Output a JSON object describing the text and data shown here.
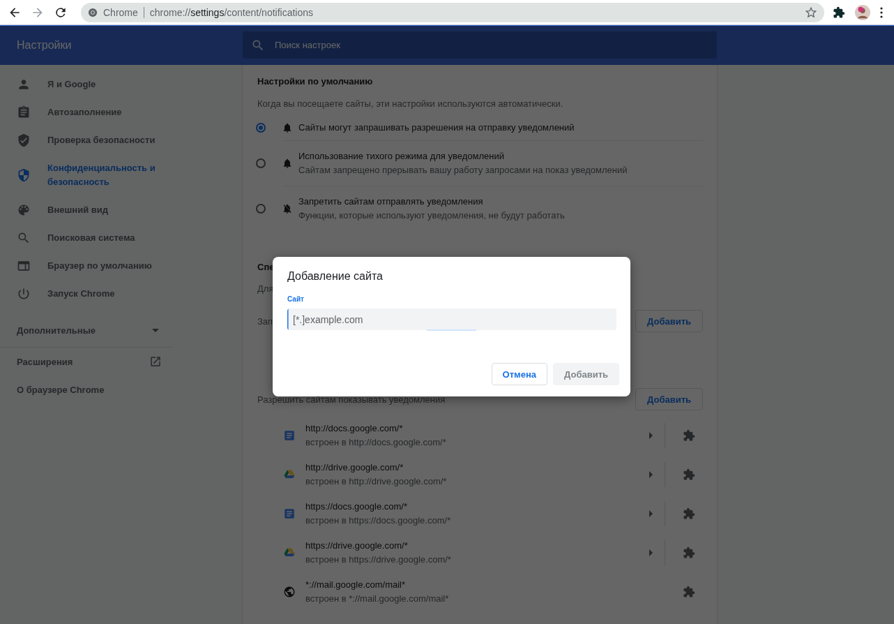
{
  "toolbar": {
    "back": {
      "disabled": false
    },
    "forward": {
      "disabled": true
    },
    "omnibox": {
      "chip": "Chrome",
      "url_scheme": "chrome://",
      "url_host": "settings",
      "url_path": "/content/notifications"
    }
  },
  "header": {
    "title": "Настройки",
    "search": {
      "placeholder": "Поиск настроек"
    }
  },
  "sidebar": {
    "items": [
      {
        "label": "Я и Google",
        "selected": false
      },
      {
        "label": "Автозаполнение",
        "selected": false
      },
      {
        "label": "Проверка безопасности",
        "selected": false
      },
      {
        "label": "Конфиденциальность и безопасность",
        "selected": true
      },
      {
        "label": "Внешний вид",
        "selected": false
      },
      {
        "label": "Поисковая система",
        "selected": false
      },
      {
        "label": "Браузер по умолчанию",
        "selected": false
      },
      {
        "label": "Запуск Chrome",
        "selected": false
      }
    ],
    "advanced": {
      "label": "Дополнительные",
      "expanded": false
    },
    "links": [
      {
        "label": "Расширения",
        "external": true
      },
      {
        "label": "О браузере Chrome",
        "external": false
      }
    ]
  },
  "defaults": {
    "heading": "Настройки по умолчанию",
    "description": "Когда вы посещаете сайты, эти настройки используются автоматически.",
    "options": [
      {
        "kind": "allow",
        "title": "Сайты могут запрашивать разрешения на отправку уведомлений",
        "selected": true
      },
      {
        "kind": "quiet",
        "title": "Использование тихого режима для уведомлений",
        "subtitle": "Сайтам запрещено прерывать вашу работу запросами на показ уведомлений",
        "selected": false
      },
      {
        "kind": "block",
        "title": "Запретить сайтам отправлять уведомления",
        "subtitle": "Функции, которые используют уведомления, не будут работать",
        "selected": false
      }
    ]
  },
  "custom": {
    "heading": "Спе",
    "description": "Для",
    "block_label": "Зап",
    "block_button": "Добавить",
    "allow_label": "Разрешить сайтам показывать уведомления",
    "allow_button": "Добавить"
  },
  "sites": [
    {
      "kind": "docs",
      "url": "http://docs.google.com/*",
      "embedded": "встроен в http://docs.google.com/*",
      "expandable": true
    },
    {
      "kind": "drive",
      "url": "http://drive.google.com/*",
      "embedded": "встроен в http://drive.google.com/*",
      "expandable": true
    },
    {
      "kind": "docs",
      "url": "https://docs.google.com/*",
      "embedded": "встроен в https://docs.google.com/*",
      "expandable": true
    },
    {
      "kind": "drive",
      "url": "https://drive.google.com/*",
      "embedded": "встроен в https://drive.google.com/*",
      "expandable": true
    },
    {
      "kind": "globe",
      "url": "*://mail.google.com/mail*",
      "embedded": "встроен в *://mail.google.com/mail*",
      "expandable": false
    }
  ],
  "dialog": {
    "title": "Добавление сайта",
    "field_label": "Сайт",
    "placeholder": "[*.]example.com",
    "cancel": {
      "label": "Отмена",
      "disabled": false
    },
    "add": {
      "label": "Добавить",
      "disabled": true
    }
  }
}
